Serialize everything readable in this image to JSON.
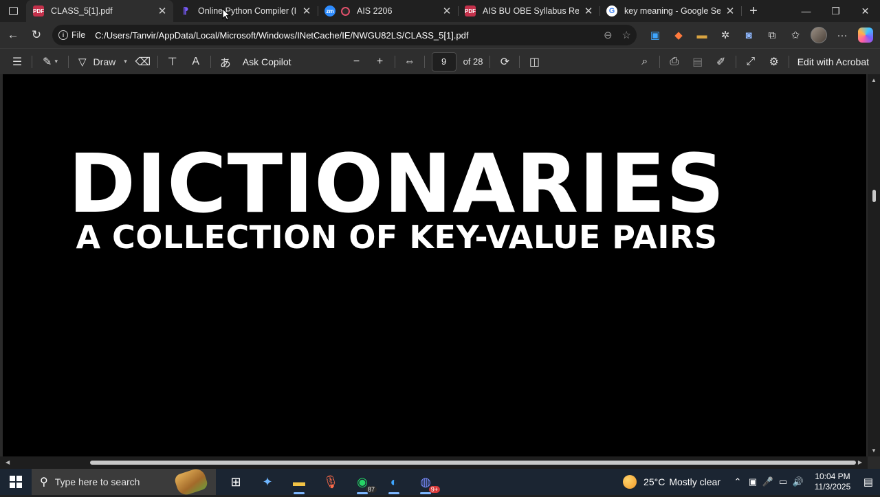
{
  "browser": {
    "tabs": [
      {
        "title": "CLASS_5[1].pdf",
        "favicon": "pdf-icon",
        "color": "#c4314b",
        "active": true
      },
      {
        "title": "Online Python Compiler (Inter",
        "favicon": "python-compiler-icon",
        "color": "#6b4cff",
        "active": false
      },
      {
        "title": "AIS 2206",
        "favicon": "zoom-recording-icon",
        "color": "#2d8cff",
        "active": false
      },
      {
        "title": "AIS BU OBE Syllabus Revised.p",
        "favicon": "pdf-icon",
        "color": "#c4314b",
        "active": false
      },
      {
        "title": "key meaning - Google Search",
        "favicon": "google-icon",
        "color": "#ffffff",
        "active": false
      }
    ],
    "address_bar": {
      "scheme_label": "File",
      "url": "C:/Users/Tanvir/AppData/Local/Microsoft/Windows/INetCache/IE/NWGU82LS/CLASS_5[1].pdf"
    }
  },
  "pdf_toolbar": {
    "draw_label": "Draw",
    "ask_copilot_label": "Ask Copilot",
    "current_page": "9",
    "page_count": "of 28",
    "edit_label": "Edit with Acrobat"
  },
  "document": {
    "title": "DICTIONARIES",
    "subtitle": "A COLLECTION OF KEY-VALUE PAIRS"
  },
  "taskbar": {
    "search_placeholder": "Type here to search",
    "whatsapp_badge": "87",
    "discord_badge": "9+",
    "weather_temp": "25°C",
    "weather_condition": "Mostly clear",
    "time": "10:04 PM",
    "date": "11/3/2025"
  },
  "colors": {
    "accent": "#7fb8ff",
    "page_background": "#000000",
    "slide_text": "#ffffff"
  }
}
